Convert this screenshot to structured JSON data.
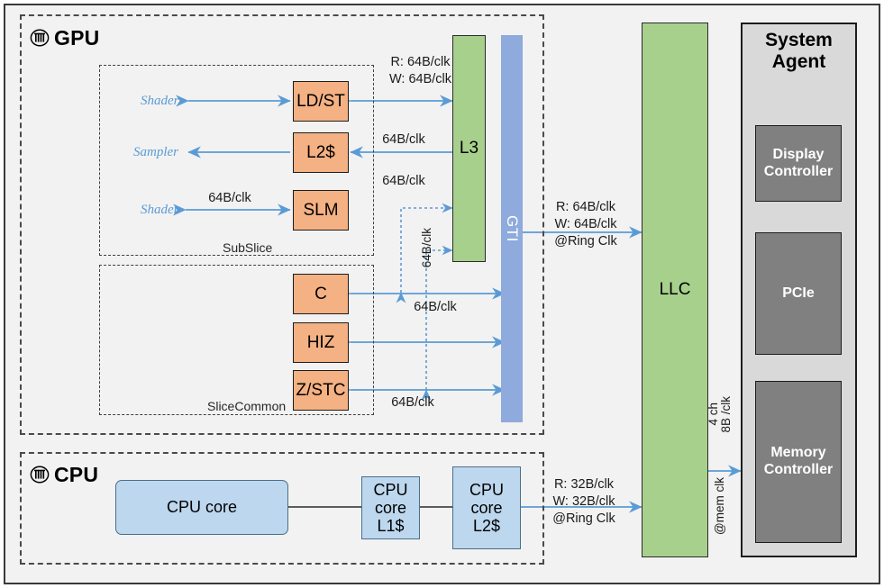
{
  "groups": {
    "gpu": {
      "title": "GPU",
      "icon": "chip-icon"
    },
    "cpu": {
      "title": "CPU",
      "icon": "chip-icon"
    },
    "subslice": {
      "label": "SubSlice"
    },
    "slicecommon": {
      "label": "SliceCommon"
    }
  },
  "gpu_blocks": {
    "ldst": "LD/ST",
    "l2": "L2$",
    "slm": "SLM",
    "c": "C",
    "hiz": "HIZ",
    "zstc": "Z/STC",
    "l3": "L3",
    "gti": "GTI"
  },
  "gpu_sources": {
    "shader_top": "Shader",
    "sampler": "Sampler",
    "shader_bottom": "Shader"
  },
  "cpu_blocks": {
    "core": "CPU core",
    "l1": "CPU\ncore\nL1$",
    "l2": "CPU\ncore\nL2$"
  },
  "uncore_blocks": {
    "llc": "LLC"
  },
  "system_agent": {
    "title": "System\nAgent",
    "display_controller": "Display\nController",
    "pcie": "PCIe",
    "memory_controller": "Memory\nController"
  },
  "bandwidth_labels": {
    "ldst_l3": "R: 64B/clk\nW: 64B/clk",
    "l2_l3": "64B/clk",
    "slm_shader": "64B/clk",
    "c_dotted": "64B/clk",
    "zstc_dotted_vertical": "64B/clk",
    "c_gti": "64B/clk",
    "zstc_gti": "64B/clk",
    "gti_llc": "R: 64B/clk\nW: 64B/clk\n@Ring Clk",
    "cpu_llc": "R: 32B/clk\nW: 32B/clk\n@Ring Clk",
    "mem_channels": "4 ch",
    "mem_width": "8B /clk",
    "mem_clk": "@mem clk"
  },
  "colors": {
    "orange": "#f4b183",
    "green": "#a8d08d",
    "gti_blue": "#8faadc",
    "cpu_blue": "#bdd7ee",
    "gray_dark": "#808080",
    "sys_agent_bg": "#d9d9d9",
    "arrow_blue": "#5b9bd5",
    "canvas": "#f2f2f2"
  }
}
